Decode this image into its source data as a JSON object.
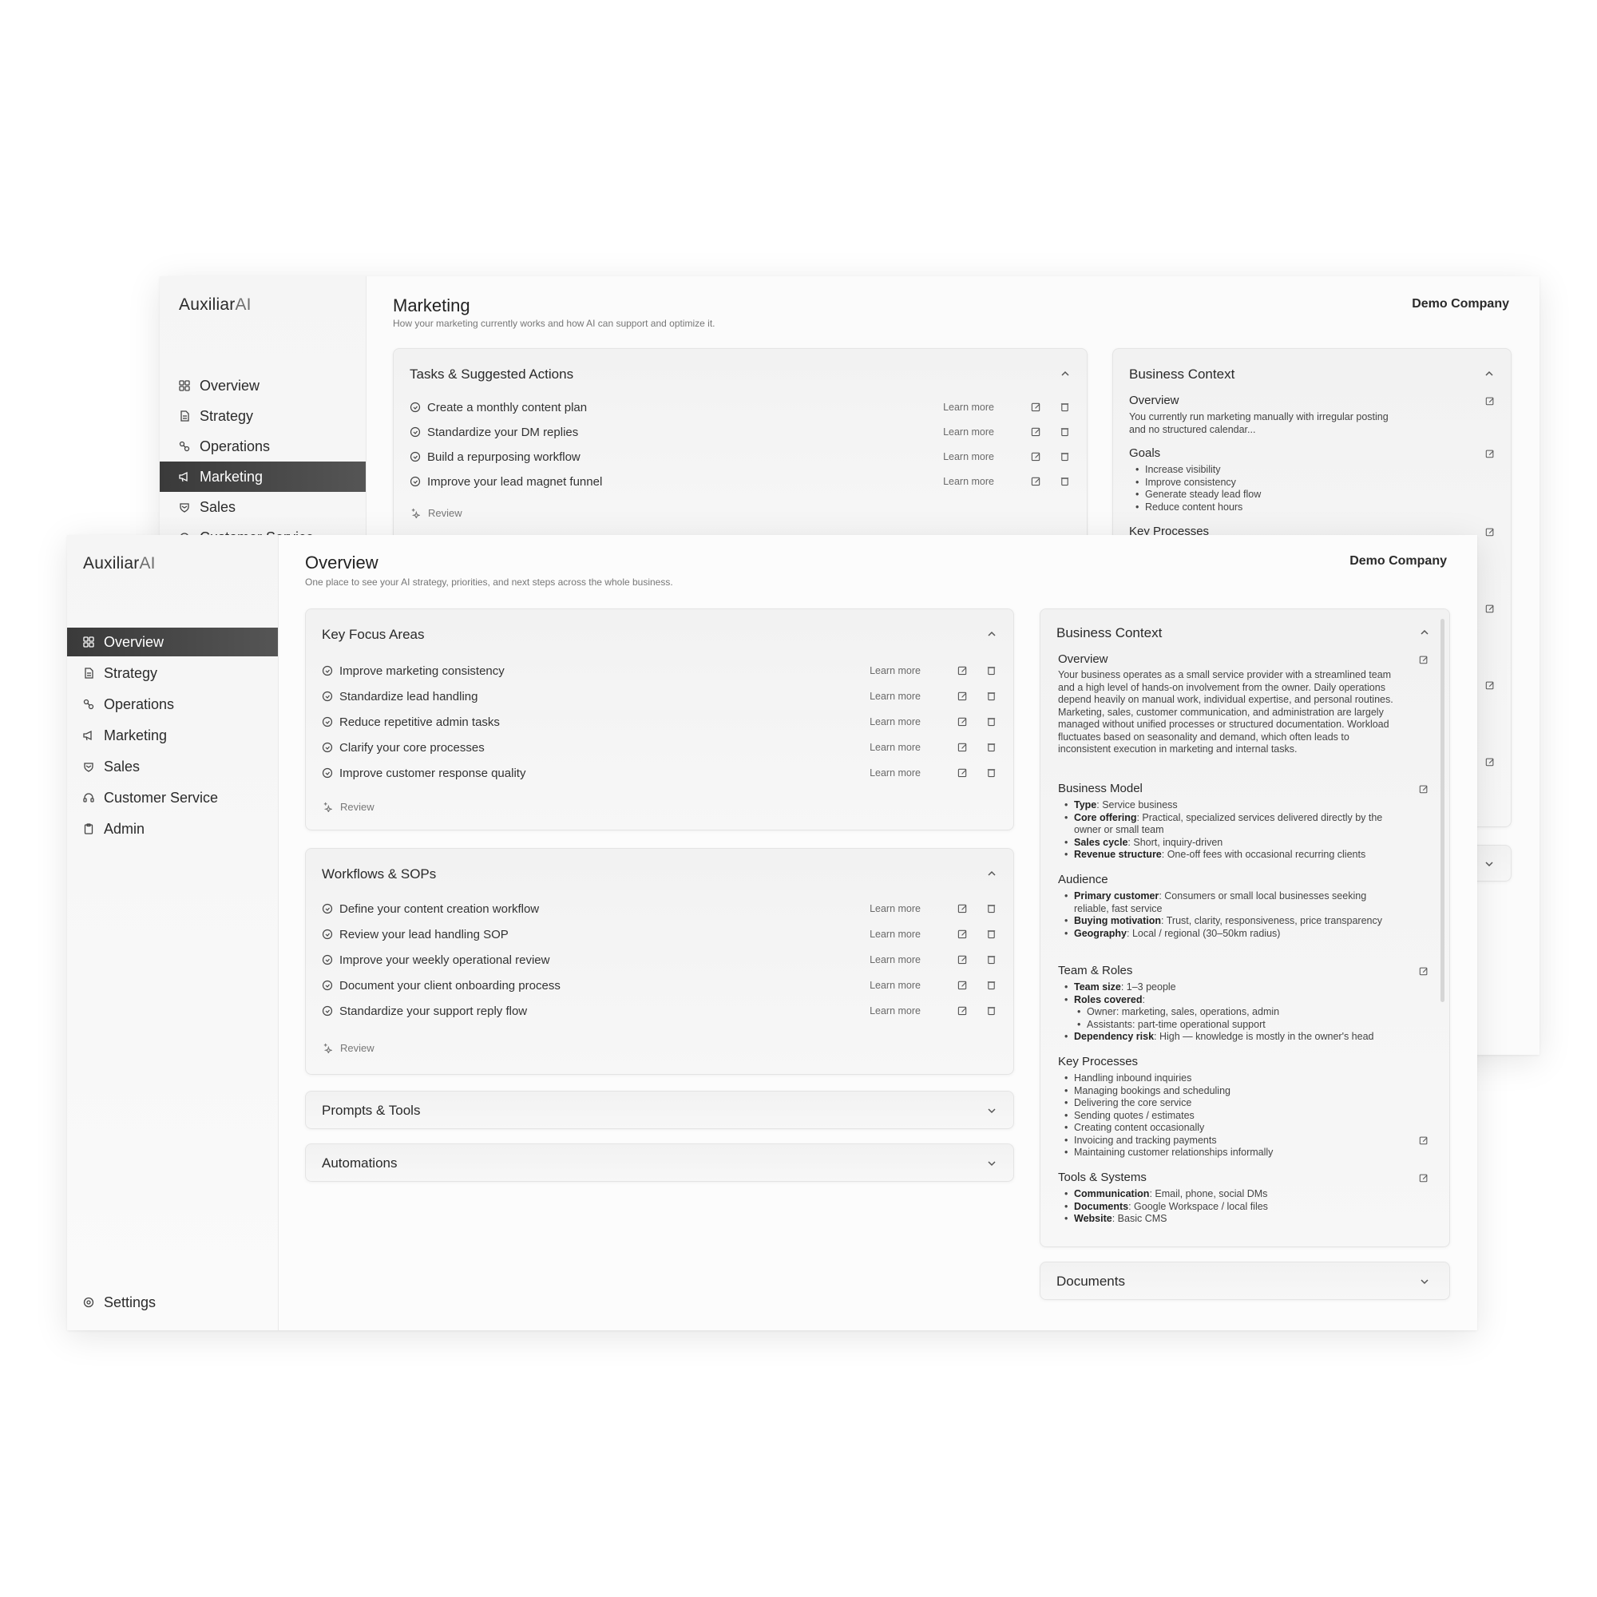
{
  "back": {
    "logo": {
      "main": "Auxiliar",
      "ai": "AI"
    },
    "title": "Marketing",
    "subtitle": "How your marketing currently works and how AI can support and optimize it.",
    "company": "Demo Company",
    "nav": [
      {
        "label": "Overview",
        "icon": "grid-icon"
      },
      {
        "label": "Strategy",
        "icon": "document-icon"
      },
      {
        "label": "Operations",
        "icon": "link-icon"
      },
      {
        "label": "Marketing",
        "icon": "megaphone-icon",
        "active": true
      },
      {
        "label": "Sales",
        "icon": "handshake-icon"
      },
      {
        "label": "Customer Service",
        "icon": "headset-icon"
      }
    ],
    "tasks": {
      "title": "Tasks & Suggested Actions",
      "items": [
        "Create a monthly content plan",
        "Standardize your DM replies",
        "Build a repurposing workflow",
        "Improve your lead magnet funnel"
      ],
      "learn_more": "Learn more",
      "review": "Review"
    },
    "context": {
      "title": "Business Context",
      "overview_h": "Overview",
      "overview_p": "You currently run marketing manually with irregular posting and no structured calendar...",
      "goals_h": "Goals",
      "goals": [
        "Increase visibility",
        "Improve consistency",
        "Generate steady lead flow",
        "Reduce content hours"
      ],
      "key_h": "Key Processes"
    }
  },
  "front": {
    "logo": {
      "main": "Auxiliar",
      "ai": "AI"
    },
    "title": "Overview",
    "subtitle": "One place to see your AI strategy, priorities, and next steps across the whole business.",
    "company": "Demo Company",
    "nav": [
      {
        "label": "Overview",
        "icon": "grid-icon",
        "active": true
      },
      {
        "label": "Strategy",
        "icon": "document-icon"
      },
      {
        "label": "Operations",
        "icon": "link-icon"
      },
      {
        "label": "Marketing",
        "icon": "megaphone-icon"
      },
      {
        "label": "Sales",
        "icon": "handshake-icon"
      },
      {
        "label": "Customer Service",
        "icon": "headset-icon"
      },
      {
        "label": "Admin",
        "icon": "clipboard-icon"
      }
    ],
    "settings": "Settings",
    "focus": {
      "title": "Key Focus Areas",
      "items": [
        "Improve marketing consistency",
        "Standardize lead handling",
        "Reduce repetitive admin tasks",
        "Clarify your core processes",
        "Improve customer response quality"
      ],
      "learn_more": "Learn more",
      "review": "Review"
    },
    "workflows": {
      "title": "Workflows & SOPs",
      "items": [
        "Define your content creation workflow",
        "Review your lead handling SOP",
        "Improve your weekly operational review",
        "Document your client onboarding process",
        "Standardize your support reply flow"
      ],
      "learn_more": "Learn more",
      "review": "Review"
    },
    "prompts": {
      "title": "Prompts & Tools"
    },
    "automations": {
      "title": "Automations"
    },
    "documents": {
      "title": "Documents"
    },
    "context": {
      "title": "Business Context",
      "overview_h": "Overview",
      "overview_p": "Your business operates as a small service provider with a streamlined team and a high level of hands-on involvement from the owner. Daily operations depend heavily on manual work, individual expertise, and personal routines. Marketing, sales, customer communication, and administration are largely managed without unified processes or structured documentation. Workload fluctuates based on seasonality and demand, which often leads to inconsistent execution in marketing and internal tasks.",
      "model_h": "Business Model",
      "model": [
        {
          "k": "Type",
          "v": ": Service business"
        },
        {
          "k": "Core offering",
          "v": ": Practical, specialized services delivered directly by the owner or small team"
        },
        {
          "k": "Sales cycle",
          "v": ": Short, inquiry-driven"
        },
        {
          "k": "Revenue structure",
          "v": ": One-off fees with occasional recurring clients"
        }
      ],
      "audience_h": "Audience",
      "audience": [
        {
          "k": "Primary customer",
          "v": ": Consumers or small local businesses seeking reliable, fast service"
        },
        {
          "k": "Buying motivation",
          "v": ": Trust, clarity, responsiveness, price transparency"
        },
        {
          "k": "Geography",
          "v": ": Local / regional (30–50km radius)"
        }
      ],
      "team_h": "Team & Roles",
      "team": {
        "size_k": "Team size",
        "size_v": ": 1–3 people",
        "roles_k": "Roles covered",
        "roles_v": ":",
        "sub1": "Owner: marketing, sales, operations, admin",
        "sub2": "Assistants: part-time operational support",
        "dep_k": "Dependency risk",
        "dep_v": ": High — knowledge is mostly in the owner's head"
      },
      "key_h": "Key Processes",
      "key": [
        "Handling inbound inquiries",
        "Managing bookings and scheduling",
        "Delivering the core service",
        "Sending quotes / estimates",
        "Creating content occasionally",
        "Invoicing and tracking payments",
        "Maintaining customer relationships informally"
      ],
      "tools_h": "Tools & Systems",
      "tools": [
        {
          "k": "Communication",
          "v": ": Email, phone, social DMs"
        },
        {
          "k": "Documents",
          "v": ": Google Workspace / local files"
        },
        {
          "k": "Website",
          "v": ": Basic CMS"
        }
      ]
    }
  }
}
